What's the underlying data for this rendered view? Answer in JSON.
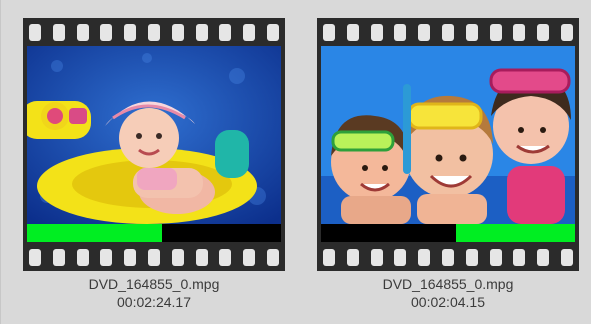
{
  "clips": [
    {
      "filename": "DVD_164855_0.mpg",
      "duration": "00:02:24.17",
      "thumbnail": "baby-in-inflatable-boat",
      "progress_fraction": 0.53,
      "progress_side": "left"
    },
    {
      "filename": "DVD_164855_0.mpg",
      "duration": "00:02:04.15",
      "thumbnail": "kids-with-swim-goggles",
      "progress_fraction": 0.47,
      "progress_side": "right"
    }
  ],
  "colors": {
    "background": "#d9d9d9",
    "film": "#2b2b2b",
    "progress_fill": "#00ee22",
    "progress_track": "#000000",
    "caption_text": "#3b3b3b"
  }
}
